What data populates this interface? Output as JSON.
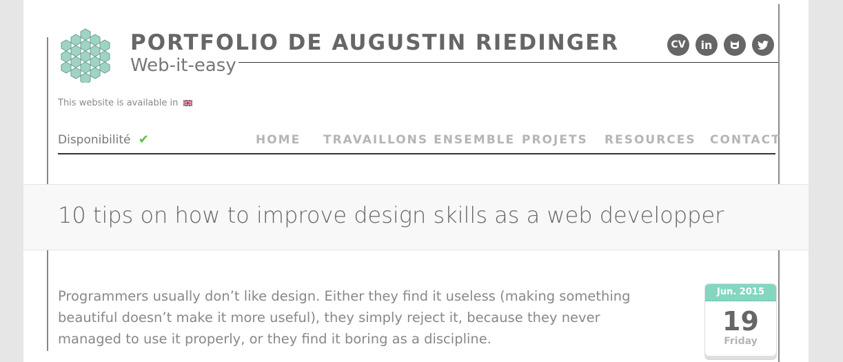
{
  "header": {
    "title": "PORTFOLIO DE AUGUSTIN RIEDINGER",
    "subtitle": "Web-it-easy",
    "logo_icon": "hexagon-honeycomb-logo",
    "social": [
      {
        "label": "CV",
        "icon": "cv-icon"
      },
      {
        "label": "in",
        "icon": "linkedin-icon"
      },
      {
        "label": "",
        "icon": "github-icon"
      },
      {
        "label": "",
        "icon": "twitter-icon"
      }
    ]
  },
  "language": {
    "text": "This website is available in",
    "flag": "uk-flag-icon"
  },
  "availability": {
    "label": "Disponibilité",
    "icon": "check-icon",
    "color": "#5cc23e"
  },
  "nav": {
    "items": [
      "HOME",
      "TRAVAILLONS ENSEMBLE",
      "PROJETS",
      "RESOURCES",
      "CONTACT"
    ]
  },
  "post": {
    "title": "10 tips on how to improve design skills as a web developper",
    "paragraph": "Programmers usually don’t like design. Either they find it useless (making something beautiful doesn’t make it more useful), they simply reject it, because they never managed to use it properly, or they find it boring as a discipline.",
    "date": {
      "month_year": "Jun. 2015",
      "day": "19",
      "weekday": "Friday",
      "accent": "#84d6c1"
    }
  }
}
